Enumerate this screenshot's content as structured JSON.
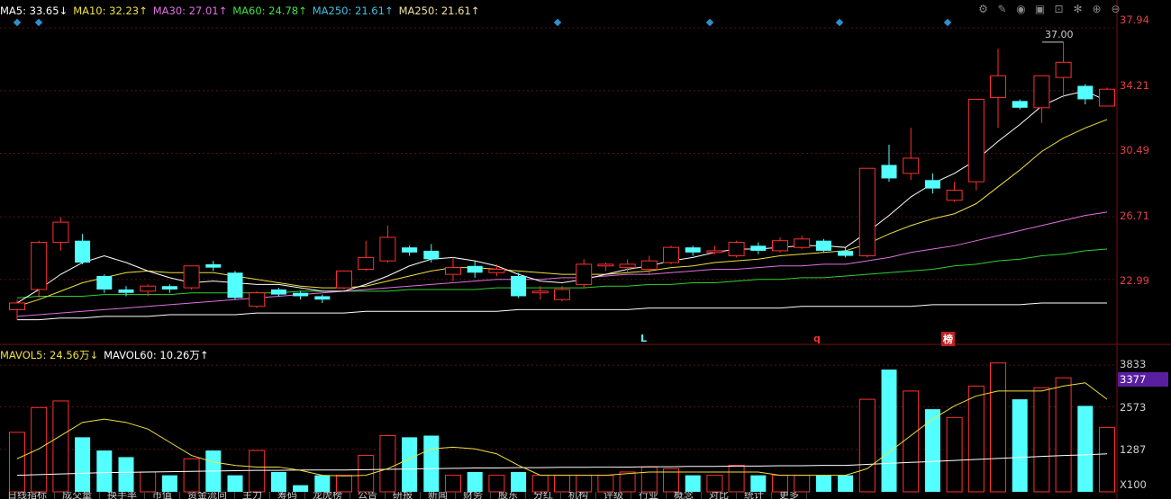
{
  "ma_legend": [
    {
      "label": "MA5: 33.65↓",
      "color": "#ffffff"
    },
    {
      "label": "MA10: 32.23↑",
      "color": "#f0e040"
    },
    {
      "label": "MA30: 27.01↑",
      "color": "#e070e0"
    },
    {
      "label": "MA60: 24.78↑",
      "color": "#40e040"
    },
    {
      "label": "MA250: 21.61↑",
      "color": "#40c0e0"
    },
    {
      "label": "MA250: 21.61↑",
      "color": "#f0e0a0"
    }
  ],
  "vol_legend": [
    {
      "label": "MAVOL5: 24.56万↓",
      "color": "#f0e040"
    },
    {
      "label": "MAVOL60: 10.26万↑",
      "color": "#ffffff"
    }
  ],
  "price_axis": [
    "37.94",
    "34.21",
    "30.49",
    "26.71",
    "22.99"
  ],
  "vol_axis": [
    "3833",
    "2573",
    "1287",
    "X100"
  ],
  "current_vol": "3377",
  "high_label": "37.00",
  "markers": {
    "l": "L",
    "q": "q",
    "bang": "榜"
  },
  "toolbar": [
    "gear-icon",
    "pen-icon",
    "eye-icon",
    "box-icon",
    "lock-icon",
    "settings-icon",
    "zoom-in-icon",
    "zoom-out-icon"
  ],
  "colors": {
    "up": "#ff3030",
    "down": "#54ffff",
    "bg": "#000000"
  },
  "chart_data": {
    "type": "candlestick",
    "price_range": [
      19.3,
      38.8
    ],
    "vol_range": [
      0,
      4000
    ],
    "candles": [
      {
        "o": 21.2,
        "c": 21.6,
        "h": 21.8,
        "l": 20.6,
        "v": 1800,
        "up": true
      },
      {
        "o": 22.4,
        "c": 25.2,
        "h": 25.3,
        "l": 21.9,
        "v": 2550,
        "up": true
      },
      {
        "o": 25.2,
        "c": 26.4,
        "h": 26.7,
        "l": 24.7,
        "v": 2750,
        "up": true
      },
      {
        "o": 25.3,
        "c": 24.0,
        "h": 25.7,
        "l": 23.9,
        "v": 1650,
        "up": false
      },
      {
        "o": 23.2,
        "c": 22.4,
        "h": 23.3,
        "l": 22.2,
        "v": 1250,
        "up": false
      },
      {
        "o": 22.4,
        "c": 22.2,
        "h": 22.6,
        "l": 22.0,
        "v": 1050,
        "up": false
      },
      {
        "o": 22.3,
        "c": 22.6,
        "h": 22.7,
        "l": 22.0,
        "v": 600,
        "up": true
      },
      {
        "o": 22.6,
        "c": 22.4,
        "h": 22.7,
        "l": 22.2,
        "v": 500,
        "up": false
      },
      {
        "o": 22.5,
        "c": 23.8,
        "h": 23.8,
        "l": 22.4,
        "v": 1000,
        "up": true
      },
      {
        "o": 23.9,
        "c": 23.7,
        "h": 24.1,
        "l": 23.5,
        "v": 1250,
        "up": false
      },
      {
        "o": 23.4,
        "c": 21.9,
        "h": 23.5,
        "l": 21.8,
        "v": 500,
        "up": false
      },
      {
        "o": 21.4,
        "c": 22.2,
        "h": 22.3,
        "l": 21.3,
        "v": 1250,
        "up": true
      },
      {
        "o": 22.4,
        "c": 22.1,
        "h": 22.5,
        "l": 22.0,
        "v": 600,
        "up": false
      },
      {
        "o": 22.2,
        "c": 22.0,
        "h": 22.3,
        "l": 21.8,
        "v": 200,
        "up": false
      },
      {
        "o": 22.0,
        "c": 21.8,
        "h": 22.1,
        "l": 21.6,
        "v": 500,
        "up": false
      },
      {
        "o": 22.5,
        "c": 23.5,
        "h": 23.5,
        "l": 22.4,
        "v": 500,
        "up": true
      },
      {
        "o": 23.6,
        "c": 24.3,
        "h": 25.3,
        "l": 23.5,
        "v": 1100,
        "up": true
      },
      {
        "o": 24.1,
        "c": 25.5,
        "h": 26.2,
        "l": 24.0,
        "v": 1700,
        "up": true
      },
      {
        "o": 24.9,
        "c": 24.6,
        "h": 25.0,
        "l": 24.4,
        "v": 1650,
        "up": false
      },
      {
        "o": 24.7,
        "c": 24.2,
        "h": 25.1,
        "l": 24.0,
        "v": 1700,
        "up": false
      },
      {
        "o": 23.3,
        "c": 23.7,
        "h": 24.3,
        "l": 22.9,
        "v": 500,
        "up": true
      },
      {
        "o": 23.8,
        "c": 23.4,
        "h": 24.1,
        "l": 23.1,
        "v": 600,
        "up": false
      },
      {
        "o": 23.4,
        "c": 23.6,
        "h": 23.9,
        "l": 23.2,
        "v": 500,
        "up": true
      },
      {
        "o": 23.2,
        "c": 22.0,
        "h": 23.4,
        "l": 21.9,
        "v": 600,
        "up": false
      },
      {
        "o": 22.2,
        "c": 22.3,
        "h": 22.6,
        "l": 21.8,
        "v": 500,
        "up": true
      },
      {
        "o": 21.8,
        "c": 22.4,
        "h": 22.6,
        "l": 21.7,
        "v": 500,
        "up": true
      },
      {
        "o": 22.7,
        "c": 23.9,
        "h": 24.2,
        "l": 22.5,
        "v": 500,
        "up": true
      },
      {
        "o": 23.8,
        "c": 23.9,
        "h": 24.0,
        "l": 23.5,
        "v": 500,
        "up": true
      },
      {
        "o": 23.7,
        "c": 23.9,
        "h": 24.2,
        "l": 23.4,
        "v": 600,
        "up": true
      },
      {
        "o": 23.6,
        "c": 24.1,
        "h": 24.4,
        "l": 23.3,
        "v": 750,
        "up": true
      },
      {
        "o": 24.0,
        "c": 24.9,
        "h": 25.0,
        "l": 23.9,
        "v": 700,
        "up": true
      },
      {
        "o": 24.9,
        "c": 24.6,
        "h": 25.0,
        "l": 24.4,
        "v": 500,
        "up": false
      },
      {
        "o": 24.6,
        "c": 24.7,
        "h": 25.0,
        "l": 24.5,
        "v": 500,
        "up": true
      },
      {
        "o": 24.4,
        "c": 25.2,
        "h": 25.3,
        "l": 24.3,
        "v": 800,
        "up": true
      },
      {
        "o": 25.0,
        "c": 24.7,
        "h": 25.2,
        "l": 24.5,
        "v": 500,
        "up": false
      },
      {
        "o": 24.7,
        "c": 25.3,
        "h": 25.5,
        "l": 24.6,
        "v": 500,
        "up": true
      },
      {
        "o": 24.9,
        "c": 25.4,
        "h": 25.6,
        "l": 24.8,
        "v": 500,
        "up": true
      },
      {
        "o": 25.3,
        "c": 24.7,
        "h": 25.4,
        "l": 24.6,
        "v": 500,
        "up": false
      },
      {
        "o": 24.7,
        "c": 24.4,
        "h": 24.9,
        "l": 24.3,
        "v": 500,
        "up": false
      },
      {
        "o": 24.4,
        "c": 29.6,
        "h": 29.6,
        "l": 24.3,
        "v": 2800,
        "up": true
      },
      {
        "o": 29.8,
        "c": 29.0,
        "h": 31.0,
        "l": 28.8,
        "v": 3700,
        "up": false
      },
      {
        "o": 29.3,
        "c": 30.2,
        "h": 32.0,
        "l": 28.9,
        "v": 3050,
        "up": true
      },
      {
        "o": 28.9,
        "c": 28.4,
        "h": 29.3,
        "l": 28.1,
        "v": 2500,
        "up": false
      },
      {
        "o": 27.7,
        "c": 28.3,
        "h": 28.8,
        "l": 27.6,
        "v": 2250,
        "up": true
      },
      {
        "o": 28.8,
        "c": 33.7,
        "h": 33.7,
        "l": 28.3,
        "v": 3200,
        "up": true
      },
      {
        "o": 33.8,
        "c": 35.1,
        "h": 36.7,
        "l": 32.0,
        "v": 3900,
        "up": true
      },
      {
        "o": 33.6,
        "c": 33.2,
        "h": 33.7,
        "l": 33.1,
        "v": 2800,
        "up": false
      },
      {
        "o": 33.2,
        "c": 35.1,
        "h": 35.1,
        "l": 32.3,
        "v": 3150,
        "up": true
      },
      {
        "o": 35.0,
        "c": 35.9,
        "h": 37.1,
        "l": 33.8,
        "v": 3450,
        "up": true
      },
      {
        "o": 34.5,
        "c": 33.7,
        "h": 34.6,
        "l": 33.4,
        "v": 2600,
        "up": false
      },
      {
        "o": 33.3,
        "c": 34.3,
        "h": 34.4,
        "l": 33.3,
        "v": 1950,
        "up": true
      }
    ],
    "ma5": [
      21.6,
      22.4,
      23.3,
      24.0,
      24.4,
      24.0,
      23.5,
      23.1,
      22.8,
      22.9,
      22.8,
      22.7,
      22.7,
      22.5,
      22.3,
      22.3,
      22.7,
      23.2,
      23.8,
      24.2,
      24.3,
      24.1,
      23.8,
      23.3,
      22.9,
      22.8,
      23.0,
      23.3,
      23.6,
      23.8,
      24.1,
      24.3,
      24.6,
      24.8,
      24.8,
      24.9,
      25.0,
      25.0,
      24.9,
      25.8,
      26.8,
      27.9,
      28.7,
      29.3,
      30.1,
      31.2,
      32.2,
      33.3,
      33.9,
      34.2,
      33.6
    ],
    "ma10": [
      21.4,
      21.8,
      22.3,
      22.8,
      23.1,
      23.4,
      23.5,
      23.4,
      23.4,
      23.4,
      23.2,
      23.0,
      22.8,
      22.6,
      22.5,
      22.5,
      22.6,
      22.9,
      23.2,
      23.5,
      23.7,
      23.7,
      23.6,
      23.5,
      23.4,
      23.3,
      23.3,
      23.3,
      23.4,
      23.5,
      23.7,
      23.8,
      24.0,
      24.1,
      24.2,
      24.4,
      24.5,
      24.6,
      24.7,
      25.1,
      25.7,
      26.2,
      26.6,
      26.9,
      27.5,
      28.5,
      29.5,
      30.6,
      31.4,
      32.0,
      32.5
    ],
    "ma30": [
      20.8,
      20.9,
      21.0,
      21.1,
      21.2,
      21.3,
      21.4,
      21.5,
      21.6,
      21.7,
      21.8,
      21.9,
      22.0,
      22.1,
      22.2,
      22.3,
      22.4,
      22.5,
      22.6,
      22.7,
      22.8,
      22.9,
      23.0,
      23.0,
      23.0,
      23.1,
      23.1,
      23.2,
      23.3,
      23.3,
      23.4,
      23.5,
      23.6,
      23.6,
      23.7,
      23.8,
      23.8,
      23.9,
      23.9,
      24.1,
      24.3,
      24.6,
      24.8,
      25.0,
      25.3,
      25.6,
      25.9,
      26.2,
      26.5,
      26.8,
      27.0
    ],
    "ma60": [
      21.9,
      22.0,
      22.0,
      22.0,
      22.1,
      22.1,
      22.1,
      22.1,
      22.2,
      22.2,
      22.2,
      22.2,
      22.2,
      22.3,
      22.3,
      22.3,
      22.3,
      22.3,
      22.4,
      22.4,
      22.4,
      22.4,
      22.5,
      22.5,
      22.5,
      22.5,
      22.5,
      22.6,
      22.6,
      22.7,
      22.7,
      22.8,
      22.8,
      22.9,
      23.0,
      23.0,
      23.1,
      23.1,
      23.2,
      23.3,
      23.4,
      23.5,
      23.6,
      23.8,
      23.9,
      24.1,
      24.2,
      24.4,
      24.5,
      24.7,
      24.8
    ],
    "ma250": [
      20.6,
      20.6,
      20.7,
      20.7,
      20.8,
      20.8,
      20.8,
      20.9,
      20.9,
      20.9,
      20.9,
      21.0,
      21.0,
      21.0,
      21.0,
      21.0,
      21.1,
      21.1,
      21.1,
      21.1,
      21.1,
      21.1,
      21.1,
      21.2,
      21.2,
      21.2,
      21.2,
      21.2,
      21.2,
      21.3,
      21.3,
      21.3,
      21.3,
      21.3,
      21.3,
      21.3,
      21.4,
      21.4,
      21.4,
      21.4,
      21.4,
      21.4,
      21.5,
      21.5,
      21.5,
      21.5,
      21.5,
      21.6,
      21.6,
      21.6,
      21.6
    ],
    "mavol5": [
      1000,
      1300,
      1700,
      2100,
      2200,
      2100,
      1900,
      1500,
      1100,
      900,
      800,
      750,
      750,
      650,
      500,
      480,
      500,
      700,
      1000,
      1300,
      1350,
      1300,
      1150,
      800,
      500,
      500,
      500,
      500,
      550,
      600,
      600,
      600,
      600,
      600,
      600,
      500,
      500,
      500,
      500,
      700,
      1200,
      1700,
      2200,
      2600,
      2900,
      3050,
      3050,
      3050,
      3200,
      3300,
      2800
    ],
    "mavol60": [
      500,
      520,
      540,
      560,
      580,
      590,
      600,
      610,
      620,
      630,
      640,
      650,
      650,
      660,
      660,
      660,
      670,
      680,
      690,
      700,
      710,
      720,
      720,
      730,
      730,
      740,
      740,
      750,
      750,
      760,
      760,
      770,
      770,
      780,
      780,
      790,
      790,
      800,
      800,
      830,
      860,
      890,
      920,
      950,
      980,
      1010,
      1040,
      1070,
      1100,
      1120,
      1150
    ]
  },
  "bottom_tabs": [
    "日线指标",
    "成交量",
    "换手率",
    "市值",
    "资金流向",
    "主力",
    "筹码",
    "龙虎榜",
    "公告",
    "研报",
    "新闻",
    "财务",
    "股东",
    "分红",
    "机构",
    "评级",
    "行业",
    "概念",
    "对比",
    "统计",
    "更多"
  ]
}
